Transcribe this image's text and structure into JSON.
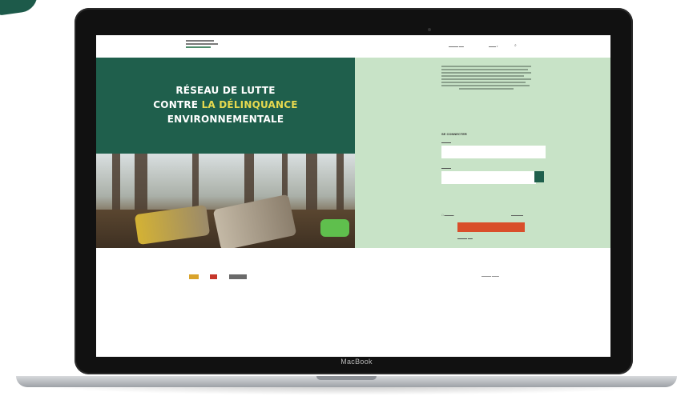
{
  "device": {
    "brand_label": "MacBook"
  },
  "hero": {
    "title_line1": "RÉSEAU DE LUTTE",
    "title_line2_prefix": "CONTRE ",
    "title_line2_accent": "LA DÉLINQUANCE",
    "title_line3": "ENVIRONNEMENTALE"
  },
  "login": {
    "title": "SE CONNECTER"
  },
  "colors": {
    "brand_green": "#1f5f4c",
    "panel_green": "#c8e3c7",
    "accent_yellow": "#e6d94f",
    "button_orange": "#d94e2a"
  }
}
